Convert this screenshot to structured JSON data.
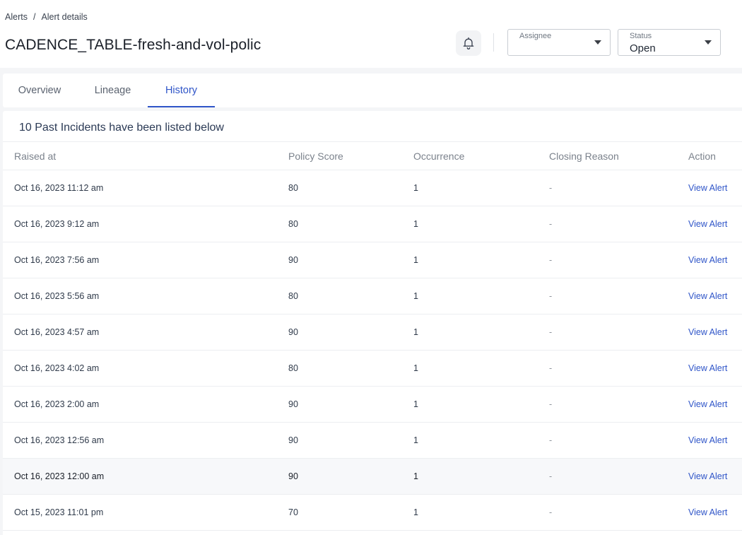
{
  "breadcrumb": {
    "root": "Alerts",
    "separator": "/",
    "current": "Alert details"
  },
  "page_title": "CADENCE_TABLE-fresh-and-vol-policy",
  "assignee": {
    "label": "Assignee",
    "value": ""
  },
  "status": {
    "label": "Status",
    "value": "Open"
  },
  "tabs": [
    {
      "label": "Overview"
    },
    {
      "label": "Lineage"
    },
    {
      "label": "History"
    }
  ],
  "active_tab": "History",
  "summary": "10 Past Incidents have been listed below",
  "table": {
    "headers": [
      "Raised at",
      "Policy Score",
      "Occurrence",
      "Closing Reason",
      "Action"
    ],
    "rows": [
      {
        "raised_at": "Oct 16, 2023 11:12 am",
        "score": "80",
        "occurrence": "1",
        "reason": "-",
        "action": "View Alert"
      },
      {
        "raised_at": "Oct 16, 2023 9:12 am",
        "score": "80",
        "occurrence": "1",
        "reason": "-",
        "action": "View Alert"
      },
      {
        "raised_at": "Oct 16, 2023 7:56 am",
        "score": "90",
        "occurrence": "1",
        "reason": "-",
        "action": "View Alert"
      },
      {
        "raised_at": "Oct 16, 2023 5:56 am",
        "score": "80",
        "occurrence": "1",
        "reason": "-",
        "action": "View Alert"
      },
      {
        "raised_at": "Oct 16, 2023 4:57 am",
        "score": "90",
        "occurrence": "1",
        "reason": "-",
        "action": "View Alert"
      },
      {
        "raised_at": "Oct 16, 2023 4:02 am",
        "score": "80",
        "occurrence": "1",
        "reason": "-",
        "action": "View Alert"
      },
      {
        "raised_at": "Oct 16, 2023 2:00 am",
        "score": "90",
        "occurrence": "1",
        "reason": "-",
        "action": "View Alert"
      },
      {
        "raised_at": "Oct 16, 2023 12:56 am",
        "score": "90",
        "occurrence": "1",
        "reason": "-",
        "action": "View Alert"
      },
      {
        "raised_at": "Oct 16, 2023 12:00 am",
        "score": "90",
        "occurrence": "1",
        "reason": "-",
        "action": "View Alert"
      },
      {
        "raised_at": "Oct 15, 2023 11:01 pm",
        "score": "70",
        "occurrence": "1",
        "reason": "-",
        "action": "View Alert"
      }
    ]
  },
  "colors": {
    "accent": "#2f55c8",
    "page_bg": "#f4f5f7"
  },
  "icons": {
    "notify": "bell-icon",
    "dropdown": "chevron-down-icon"
  }
}
